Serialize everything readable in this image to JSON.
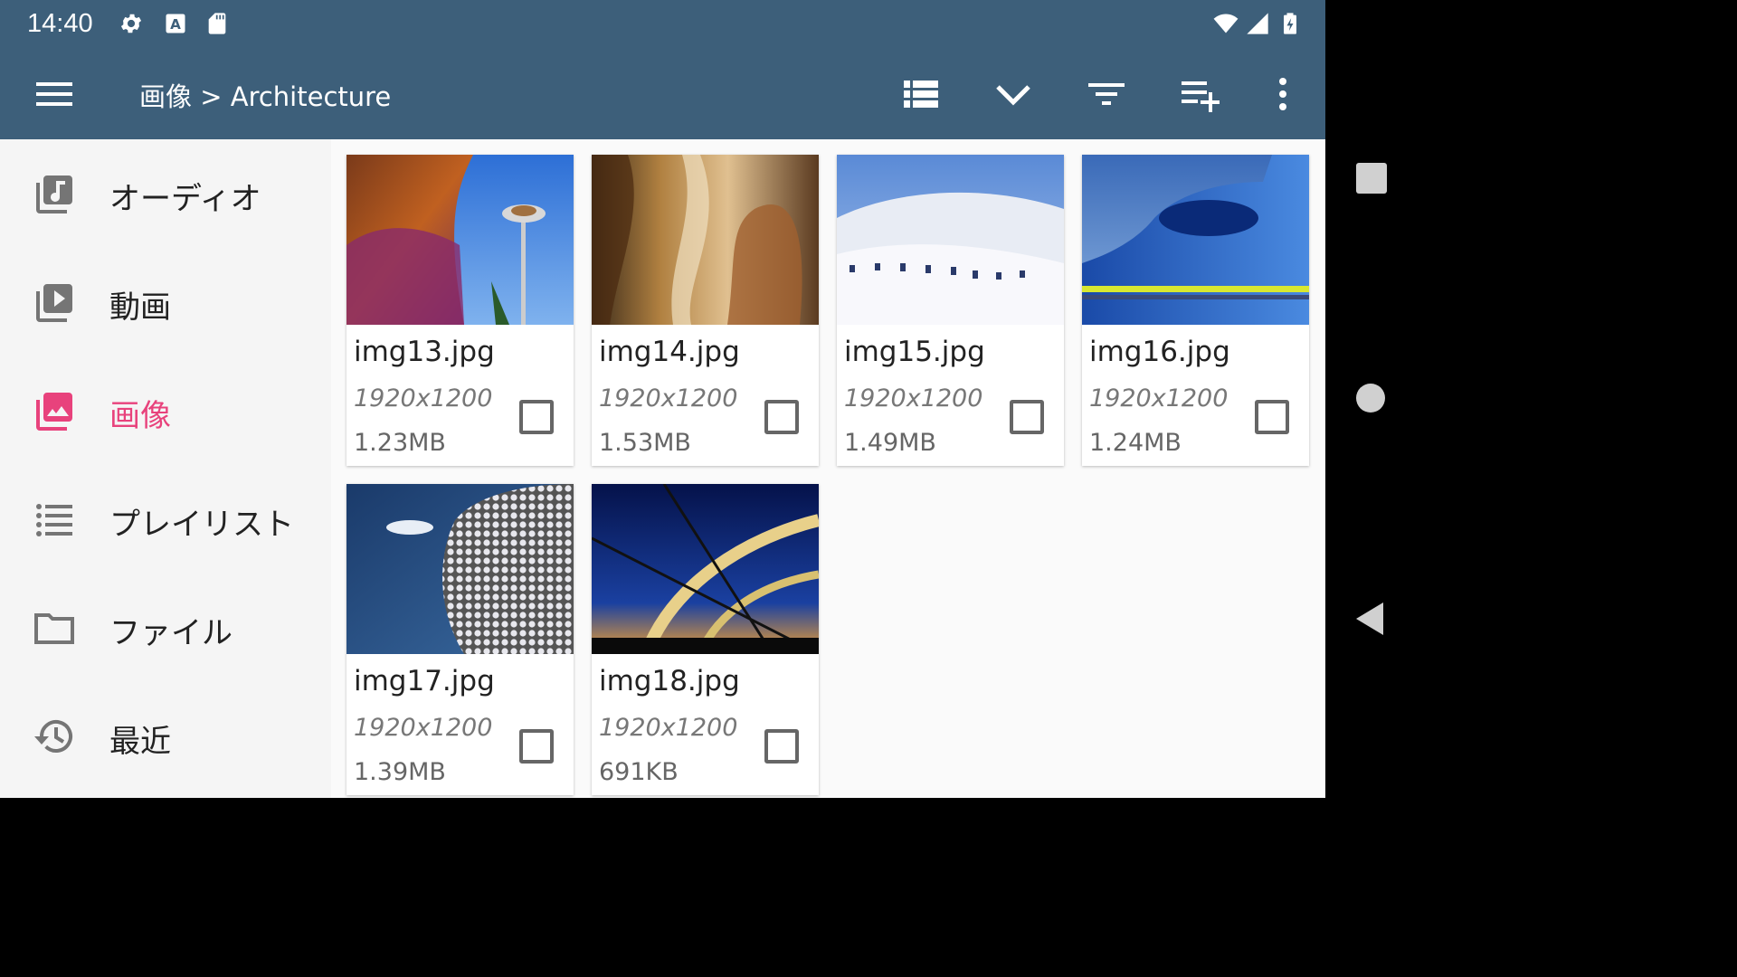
{
  "status_bar": {
    "time": "14:40",
    "icons": [
      "settings-icon",
      "a-text-icon",
      "sd-card-icon",
      "wifi-icon",
      "signal-icon",
      "battery-charging-icon"
    ]
  },
  "toolbar": {
    "menu_icon": "hamburger-menu-icon",
    "breadcrumb": "画像 > Architecture",
    "actions": [
      {
        "name": "view-list-button",
        "icon": "view-list-icon"
      },
      {
        "name": "expand-button",
        "icon": "chevron-down-icon"
      },
      {
        "name": "filter-button",
        "icon": "filter-icon"
      },
      {
        "name": "add-to-playlist-button",
        "icon": "playlist-add-icon"
      },
      {
        "name": "more-options-button",
        "icon": "more-vert-icon"
      }
    ]
  },
  "sidebar": {
    "items": [
      {
        "label": "オーディオ",
        "icon": "audio-library-icon",
        "active": false
      },
      {
        "label": "動画",
        "icon": "video-library-icon",
        "active": false
      },
      {
        "label": "画像",
        "icon": "photo-library-icon",
        "active": true
      },
      {
        "label": "プレイリスト",
        "icon": "list-icon",
        "active": false
      },
      {
        "label": "ファイル",
        "icon": "folder-icon",
        "active": false
      },
      {
        "label": "最近",
        "icon": "history-icon",
        "active": false
      }
    ],
    "active_color": "#e8427c"
  },
  "files": [
    {
      "name": "img13.jpg",
      "resolution": "1920x1200",
      "size": "1.23MB",
      "checked": false
    },
    {
      "name": "img14.jpg",
      "resolution": "1920x1200",
      "size": "1.53MB",
      "checked": false
    },
    {
      "name": "img15.jpg",
      "resolution": "1920x1200",
      "size": "1.49MB",
      "checked": false
    },
    {
      "name": "img16.jpg",
      "resolution": "1920x1200",
      "size": "1.24MB",
      "checked": false
    },
    {
      "name": "img17.jpg",
      "resolution": "1920x1200",
      "size": "1.39MB",
      "checked": false
    },
    {
      "name": "img18.jpg",
      "resolution": "1920x1200",
      "size": "691KB",
      "checked": false
    }
  ],
  "colors": {
    "toolbar": "#3d5f7a",
    "accent": "#e8427c",
    "background": "#f5f5f5"
  },
  "system_nav": [
    "recents-button",
    "home-button",
    "back-button"
  ]
}
